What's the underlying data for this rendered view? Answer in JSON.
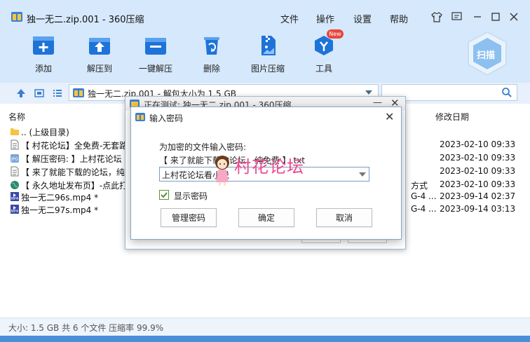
{
  "window": {
    "title": "独一无二.zip.001 - 360压缩",
    "menu": [
      "文件",
      "操作",
      "设置",
      "帮助"
    ]
  },
  "toolbar": {
    "items": [
      {
        "label": "添加",
        "icon": "add-icon"
      },
      {
        "label": "解压到",
        "icon": "extract-to-icon"
      },
      {
        "label": "一键解压",
        "icon": "one-click-extract-icon"
      },
      {
        "label": "删除",
        "icon": "delete-icon"
      },
      {
        "label": "图片压缩",
        "icon": "image-compress-icon"
      },
      {
        "label": "工具",
        "icon": "tools-icon"
      }
    ],
    "tools_badge": "New",
    "scan_label": "扫描"
  },
  "addressbar": {
    "path": "独一无二.zip.001 - 解包大小为 1.5 GB"
  },
  "list": {
    "columns": {
      "name": "名称",
      "modified": "修改日期"
    },
    "rows": [
      {
        "name": ".. (上级目录)",
        "extra": "",
        "date": "",
        "icon": "folder-icon"
      },
      {
        "name": "【 村花论坛】全免费-无套路",
        "extra": "",
        "date": "2023-02-10 09:33",
        "icon": "text-file-icon"
      },
      {
        "name": "【 解压密码: 】上村花论坛",
        "extra": "",
        "date": "2023-02-10 09:33",
        "icon": "jpg-file-icon"
      },
      {
        "name": "【 来了就能下载的论坛，纯",
        "extra": "",
        "date": "2023-02-10 09:33",
        "icon": "text-file-icon"
      },
      {
        "name": "【 永久地址发布页】-点此打",
        "extra": "方式",
        "date": "2023-02-10 09:33",
        "icon": "globe-icon"
      },
      {
        "name": "独一无二96s.mp4 *",
        "extra": "G-4 ...",
        "date": "2023-09-14 02:37",
        "icon": "mp4-file-icon"
      },
      {
        "name": "独一无二97s.mp4 *",
        "extra": "G-4 ...",
        "date": "2023-09-14 03:13",
        "icon": "mp4-file-icon"
      }
    ]
  },
  "status": {
    "text": "大小: 1.5 GB 共 6 个文件 压缩率 99.9%"
  },
  "testing_dialog": {
    "title": "正在测试: 独一无二.zip.001 - 360压缩"
  },
  "password_dialog": {
    "title": "输入密码",
    "prompt": "为加密的文件输入密码:",
    "file": "【 来了就能下载的论坛，纯免费 】.txt",
    "password_value": "上村花论坛看小说",
    "show_password_label": "显示密码",
    "show_password_checked": true,
    "buttons": {
      "manage": "管理密码",
      "ok": "确定",
      "cancel": "取消"
    }
  },
  "watermark": {
    "text": "村花论坛"
  },
  "colors": {
    "accent": "#1e73d8",
    "toolbar_bg": "#d6e8fb",
    "new_badge": "#e8473c",
    "watermark": "#ef4a8f"
  }
}
